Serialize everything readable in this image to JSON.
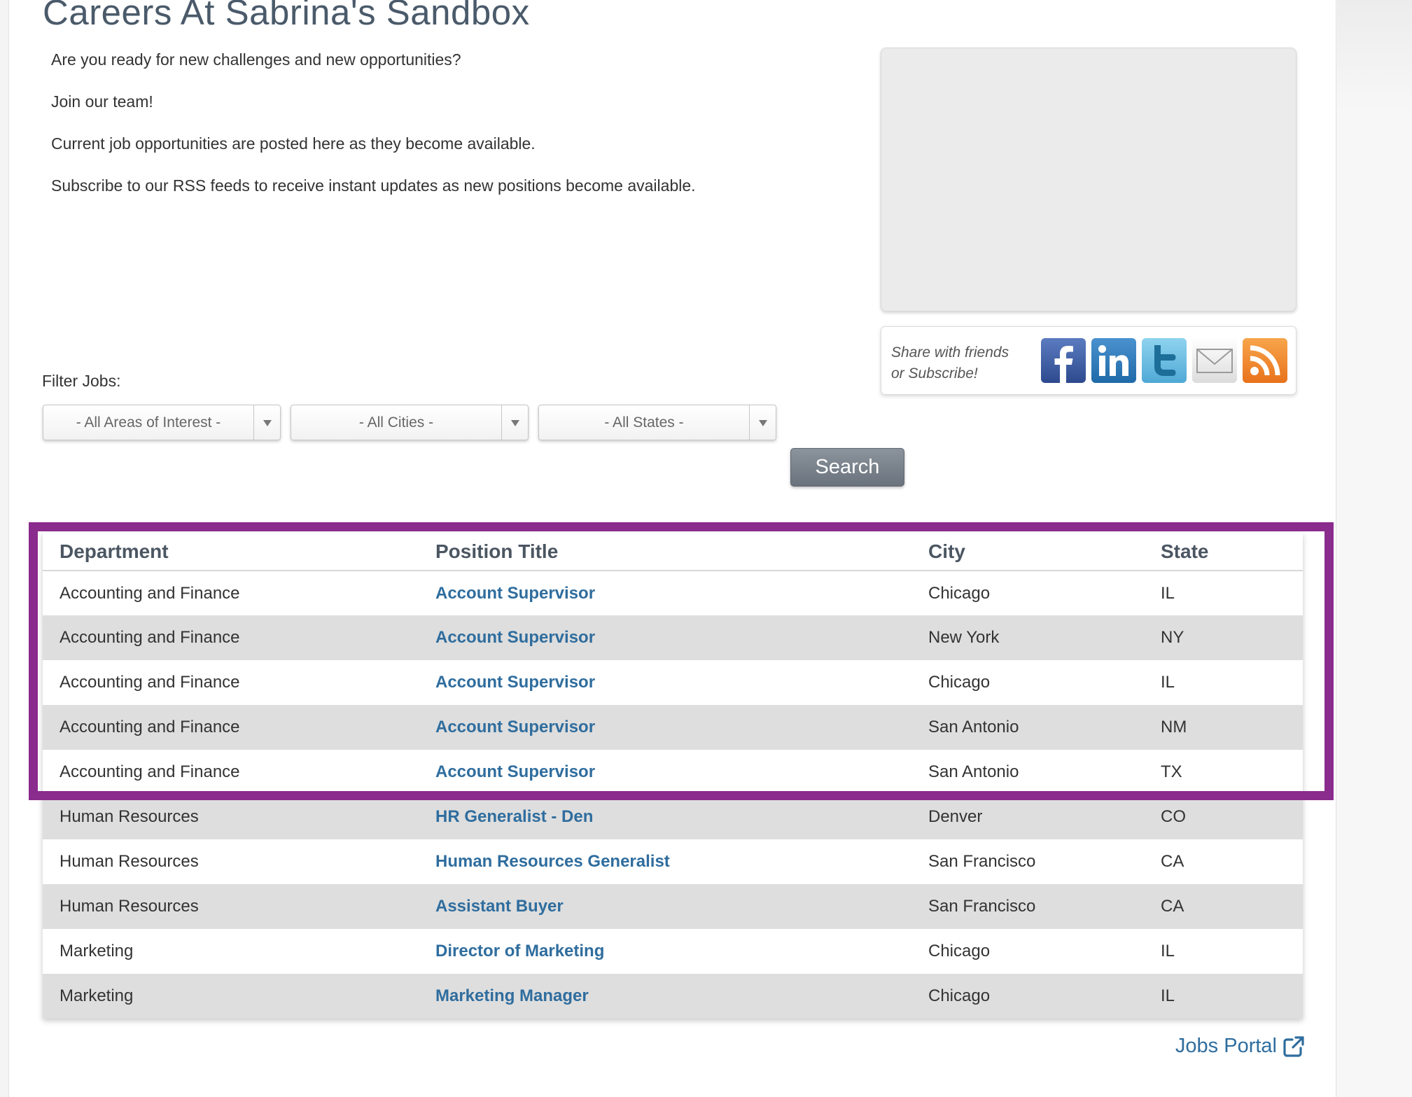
{
  "page": {
    "title": "Careers At Sabrina's Sandbox"
  },
  "intro": {
    "paragraphs": [
      "Are you ready for new challenges and new opportunities?",
      "Join our team!",
      "Current job opportunities are posted here as they become available.",
      "Subscribe to our RSS feeds to receive instant updates as new positions become available."
    ]
  },
  "share": {
    "line1": "Share with friends",
    "line2": "or Subscribe!",
    "icons": [
      "facebook-icon",
      "linkedin-icon",
      "twitter-icon",
      "email-icon",
      "rss-icon"
    ]
  },
  "filter": {
    "label": "Filter Jobs:",
    "areas": "- All Areas of Interest -",
    "cities": "- All Cities -",
    "states": "- All States -",
    "search_label": "Search"
  },
  "table": {
    "headers": [
      "Department",
      "Position Title",
      "City",
      "State"
    ],
    "rows": [
      [
        "Accounting and Finance",
        "Account Supervisor",
        "Chicago",
        "IL"
      ],
      [
        "Accounting and Finance",
        "Account Supervisor",
        "New York",
        "NY"
      ],
      [
        "Accounting and Finance",
        "Account Supervisor",
        "Chicago",
        "IL"
      ],
      [
        "Accounting and Finance",
        "Account Supervisor",
        "San Antonio",
        "NM"
      ],
      [
        "Accounting and Finance",
        "Account Supervisor",
        "San Antonio",
        "TX"
      ],
      [
        "Human Resources",
        "HR Generalist - Den",
        "Denver",
        "CO"
      ],
      [
        "Human Resources",
        "Human Resources Generalist",
        "San Francisco",
        "CA"
      ],
      [
        "Human Resources",
        "Assistant Buyer",
        "San Francisco",
        "CA"
      ],
      [
        "Marketing",
        "Director of Marketing",
        "Chicago",
        "IL"
      ],
      [
        "Marketing",
        "Marketing Manager",
        "Chicago",
        "IL"
      ]
    ]
  },
  "footer": {
    "portal_label": "Jobs Portal"
  },
  "colors": {
    "highlight": "#8a2b8e",
    "link": "#2f6d9e",
    "heading": "#4a5a6a"
  }
}
